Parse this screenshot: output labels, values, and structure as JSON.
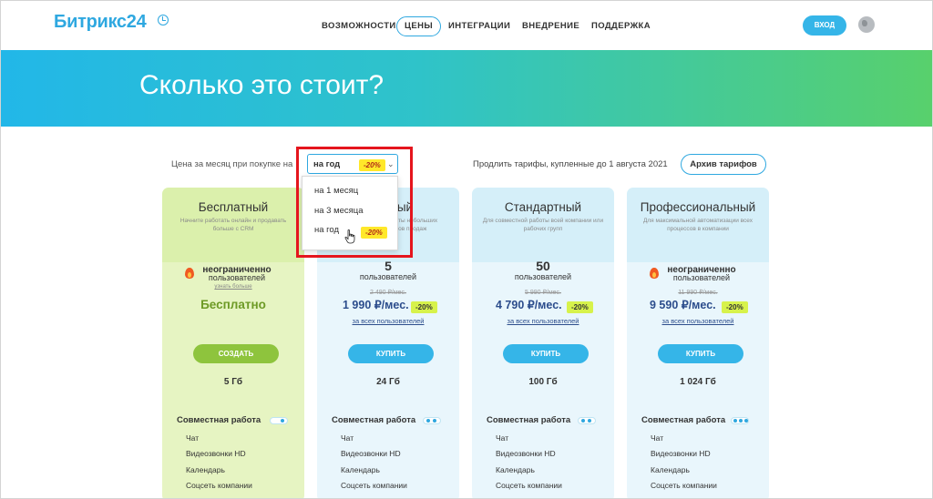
{
  "header": {
    "logo": "Битрикс24",
    "nav": [
      "ВОЗМОЖНОСТИ",
      "ЦЕНЫ",
      "ИНТЕГРАЦИИ",
      "ВНЕДРЕНИЕ",
      "ПОДДЕРЖКА"
    ],
    "active_nav": "ЦЕНЫ",
    "login": "ВХОД"
  },
  "hero": {
    "title": "Сколько это стоит?"
  },
  "controls": {
    "price_label": "Цена за месяц при покупке на",
    "period_value": "на год",
    "period_discount": "-20%",
    "renew_label": "Продлить тарифы, купленные до 1 августа 2021",
    "archive_button": "Архив тарифов"
  },
  "dropdown": {
    "options": [
      "на 1 месяц",
      "на 3 месяца",
      "на год"
    ],
    "discount": "-20%"
  },
  "plans": [
    {
      "name": "Бесплатный",
      "desc": "Начните работать онлайн и продавать больше с CRM",
      "users_line1": "неограниченно",
      "users_line2": "пользователей",
      "sub": "узнать больше",
      "price": "Бесплатно",
      "cta": "СОЗДАТЬ",
      "storage": "5 Гб",
      "section": "Совместная работа",
      "features": [
        "Чат",
        "Видеозвонки HD",
        "Календарь",
        "Соцсеть компании"
      ]
    },
    {
      "name": "Базовый",
      "desc": "Для совместной работы небольших компаний и отделов продаж",
      "users_num": "5",
      "users_lbl": "пользователей",
      "old_price": "2 490 ₽/мес.",
      "price": "1 990 ₽/мес.",
      "discount": "-20%",
      "all_users": "за всех пользователей",
      "cta": "КУПИТЬ",
      "storage": "24 Гб",
      "section": "Совместная работа",
      "features": [
        "Чат",
        "Видеозвонки HD",
        "Календарь",
        "Соцсеть компании"
      ]
    },
    {
      "name": "Стандартный",
      "desc": "Для совместной работы всей компании или рабочих групп",
      "users_num": "50",
      "users_lbl": "пользователей",
      "old_price": "5 990 ₽/мес.",
      "price": "4 790 ₽/мес.",
      "discount": "-20%",
      "all_users": "за всех пользователей",
      "cta": "КУПИТЬ",
      "storage": "100 Гб",
      "section": "Совместная работа",
      "features": [
        "Чат",
        "Видеозвонки HD",
        "Календарь",
        "Соцсеть компании"
      ]
    },
    {
      "name": "Профессиональный",
      "desc": "Для максимальной автоматизации всех процессов в компании",
      "users_line1": "неограниченно",
      "users_line2": "пользователей",
      "old_price": "11 990 ₽/мес.",
      "price": "9 590 ₽/мес.",
      "discount": "-20%",
      "all_users": "за всех пользователей",
      "cta": "КУПИТЬ",
      "storage": "1 024 Гб",
      "section": "Совместная работа",
      "features": [
        "Чат",
        "Видеозвонки HD",
        "Календарь",
        "Соцсеть компании"
      ]
    }
  ],
  "colors": {
    "accent": "#2fa8e0",
    "highlight": "#e5151d",
    "discount": "#ffe82a"
  },
  "icons": [
    "clock-icon",
    "globe-icon",
    "fire-icon",
    "chevron-down-icon",
    "hand-cursor-icon"
  ]
}
